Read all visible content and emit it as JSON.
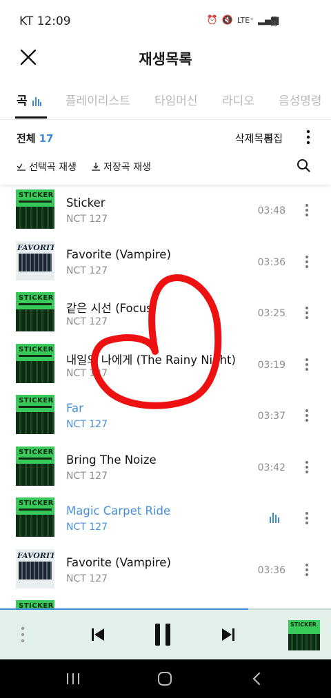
{
  "status": {
    "carrier_time": "KT 12:09",
    "network": "LTE⁺"
  },
  "header": {
    "title": "재생목록"
  },
  "tabs": [
    {
      "label": "곡"
    },
    {
      "label": "플레이리스트"
    },
    {
      "label": "타임머신"
    },
    {
      "label": "라디오"
    },
    {
      "label": "음성명령"
    }
  ],
  "toolbar": {
    "all_label": "전체",
    "count": "17",
    "delete_label": "삭제목록",
    "edit_label": "편집"
  },
  "actions": {
    "play_selected": "선택곡 재생",
    "play_saved": "저장곡 재생"
  },
  "songs": [
    {
      "title": "Sticker",
      "artist": "NCT 127",
      "duration": "03:48",
      "cover": "STICKER"
    },
    {
      "title": "Favorite (Vampire)",
      "artist": "NCT 127",
      "duration": "03:36",
      "cover": "FAVORITE"
    },
    {
      "title": "같은 시선 (Focus)",
      "artist": "NCT 127",
      "duration": "03:25",
      "cover": "STICKER"
    },
    {
      "title": "내일의 나에게 (The Rainy Night)",
      "artist": "NCT 127",
      "duration": "03:19",
      "cover": "STICKER"
    },
    {
      "title": "Far",
      "artist": "NCT 127",
      "duration": "03:37",
      "cover": "STICKER"
    },
    {
      "title": "Bring The Noize",
      "artist": "NCT 127",
      "duration": "03:42",
      "cover": "STICKER"
    },
    {
      "title": "Magic Carpet Ride",
      "artist": "NCT 127",
      "duration": "",
      "cover": "STICKER"
    },
    {
      "title": "Favorite (Vampire)",
      "artist": "NCT 127",
      "duration": "03:36",
      "cover": "FAVORITE"
    }
  ],
  "player": {
    "progress": 0.75,
    "thumb_text": "STICKER"
  },
  "colors": {
    "accent": "#3f8ad8",
    "player_bg": "#e3efe9",
    "annotation": "#ee1111"
  }
}
